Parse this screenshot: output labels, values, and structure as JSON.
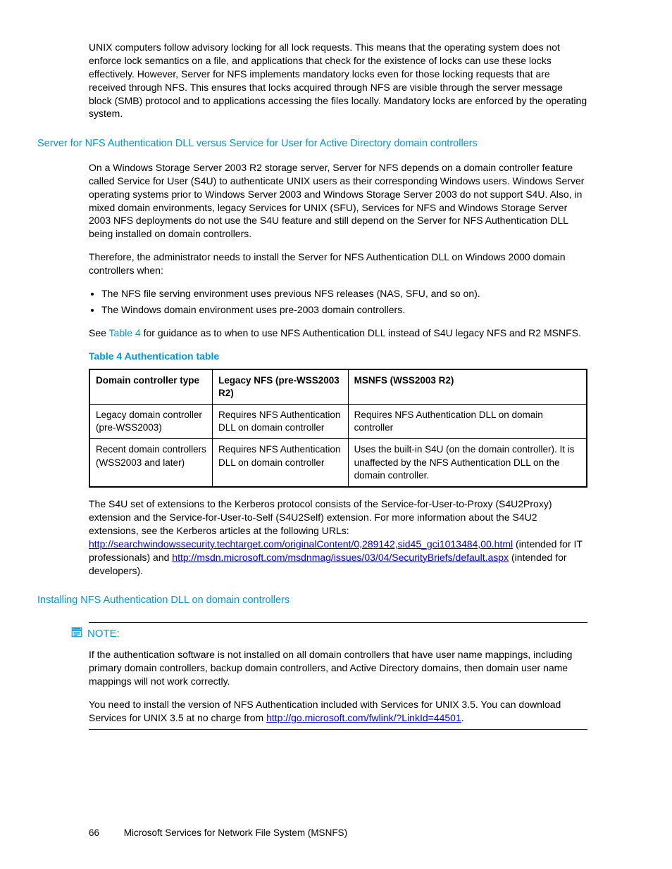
{
  "para_intro": "UNIX computers follow advisory locking for all lock requests. This means that the operating system does not enforce lock semantics on a file, and applications that check for the existence of locks can use these locks effectively. However, Server for NFS implements mandatory locks even for those locking requests that are received through NFS. This ensures that locks acquired through NFS are visible through the server message block (SMB) protocol and to applications accessing the files locally. Mandatory locks are enforced by the operating system.",
  "h1": "Server for NFS Authentication DLL versus Service for User for Active Directory domain controllers",
  "para2": "On a Windows Storage Server 2003 R2 storage server, Server for NFS depends on a domain controller feature called Service for User (S4U) to authenticate UNIX users as their corresponding Windows users. Windows Server operating systems prior to Windows Server 2003 and Windows Storage Server 2003 do not support S4U. Also, in mixed domain environments, legacy Services for UNIX (SFU), Services for NFS and Windows Storage Server 2003 NFS deployments do not use the S4U feature and still depend on the Server for NFS Authentication DLL being installed on domain controllers.",
  "para3": "Therefore, the administrator needs to install the Server for NFS Authentication DLL on Windows 2000 domain controllers when:",
  "bullets": [
    "The NFS file serving environment uses previous NFS releases (NAS, SFU, and so on).",
    "The Windows domain environment uses pre-2003 domain controllers."
  ],
  "para4_pre": "See ",
  "para4_link": "Table 4",
  "para4_post": " for guidance as to when to use NFS Authentication DLL instead of S4U legacy NFS and R2 MSNFS.",
  "table_caption": "Table 4 Authentication table",
  "table": {
    "headers": [
      "Domain controller type",
      "Legacy NFS (pre-WSS2003 R2)",
      "MSNFS (WSS2003 R2)"
    ],
    "rows": [
      [
        "Legacy domain controller (pre-WSS2003)",
        "Requires NFS Authentication DLL on domain controller",
        "Requires NFS Authentication DLL on domain controller"
      ],
      [
        "Recent domain controllers (WSS2003 and later)",
        "Requires NFS Authentication DLL on domain controller",
        "Uses the built-in S4U (on the domain controller). It is unaffected by the NFS Authentication DLL on the domain controller."
      ]
    ]
  },
  "para5_a": "The S4U set of extensions to the Kerberos protocol consists of the Service-for-User-to-Proxy (S4U2Proxy) extension and the Service-for-User-to-Self (S4U2Self) extension. For more information about the S4U2 extensions, see the Kerberos articles at the following URLs: ",
  "link1": "http://searchwindowssecurity.techtarget.com/originalContent/0,289142,sid45_gci1013484,00.html",
  "para5_b": " (intended for IT professionals) and ",
  "link2": "http://msdn.microsoft.com/msdnmag/issues/03/04/SecurityBriefs/default.aspx",
  "para5_c": " (intended for developers).",
  "h2": "Installing NFS Authentication DLL on domain controllers",
  "note_label": "NOTE:",
  "note_p1": "If the authentication software is not installed on all domain controllers that have user name mappings, including primary domain controllers, backup domain controllers, and Active Directory domains, then domain user name mappings will not work correctly.",
  "note_p2_a": "You need to install the version of NFS Authentication included with Services for UNIX 3.5. You can download Services for UNIX 3.5 at no charge from ",
  "note_link": "http://go.microsoft.com/fwlink/?LinkId=44501",
  "note_p2_b": ".",
  "footer_page": "66",
  "footer_title": "Microsoft Services for Network File System (MSNFS)"
}
